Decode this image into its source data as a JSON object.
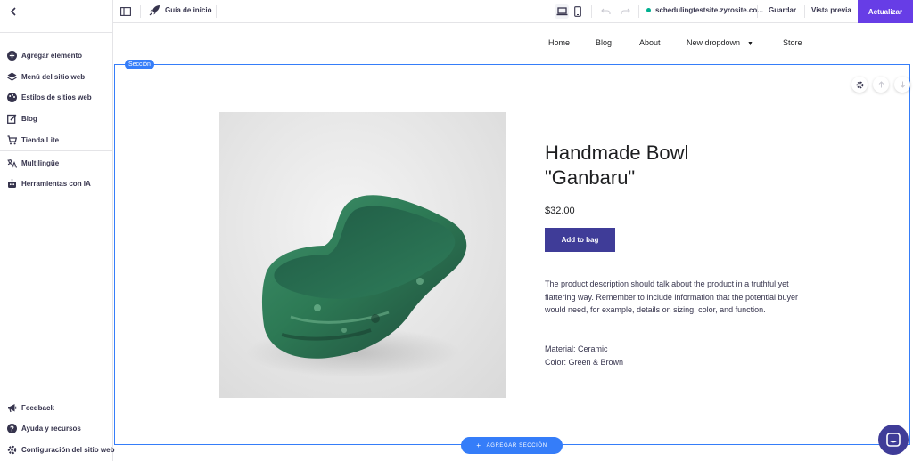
{
  "sidebar": {
    "back_icon": "chevron-left-icon",
    "items": [
      {
        "label": "Agregar elemento",
        "icon": "plus-circle-icon"
      },
      {
        "label": "Menú del sitio web",
        "icon": "layers-icon"
      },
      {
        "label": "Estilos de sitios web",
        "icon": "palette-icon"
      },
      {
        "label": "Blog",
        "icon": "edit-icon"
      },
      {
        "label": "Tienda Lite",
        "icon": "cart-icon"
      },
      {
        "label": "Multilingüe",
        "icon": "translate-icon"
      },
      {
        "label": "Herramientas con IA",
        "icon": "robot-icon"
      }
    ],
    "bottom_items": [
      {
        "label": "Feedback",
        "icon": "megaphone-icon"
      },
      {
        "label": "Ayuda y recursos",
        "icon": "help-icon"
      },
      {
        "label": "Configuración del sitio web",
        "icon": "gear-icon"
      }
    ]
  },
  "toolbar": {
    "guide_label": "Guía de inicio",
    "domain": "schedulingtestsite.zyrosite.co...",
    "save_label": "Guardar",
    "preview_label": "Vista previa",
    "update_label": "Actualizar"
  },
  "site_nav": {
    "items": [
      "Home",
      "Blog",
      "About",
      "New dropdown",
      "Store"
    ]
  },
  "section": {
    "tag_label": "Sección",
    "add_section_label": "AGREGAR SECCIÓN"
  },
  "product": {
    "title_line1": "Handmade Bowl",
    "title_line2": "\"Ganbaru\"",
    "price": "$32.00",
    "add_button": "Add to bag",
    "description": "The product description should talk about the product in a truthful yet flattering way. Remember to include information that the potential buyer would need, for example, details on sizing, color, and function.",
    "material": "Material: Ceramic",
    "color": "Color: Green & Brown"
  },
  "colors": {
    "accent": "#673de6",
    "section_outline": "#357df9",
    "button": "#3f3c98",
    "online_dot": "#00b090"
  }
}
